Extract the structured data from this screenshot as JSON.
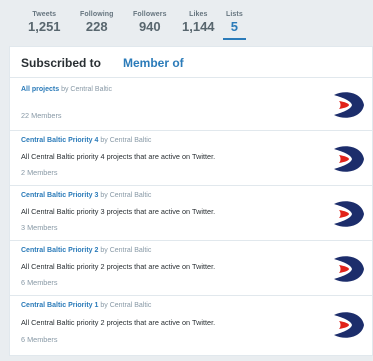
{
  "profile_nav": {
    "tweets": {
      "label": "Tweets",
      "value": "1,251"
    },
    "following": {
      "label": "Following",
      "value": "228"
    },
    "followers": {
      "label": "Followers",
      "value": "940"
    },
    "likes": {
      "label": "Likes",
      "value": "1,144"
    },
    "lists": {
      "label": "Lists",
      "value": "5"
    }
  },
  "panel": {
    "tab_subscribed": "Subscribed to",
    "tab_member": "Member of"
  },
  "lists": [
    {
      "name": "All projects",
      "by": "by Central Baltic",
      "description": "",
      "members": "22 Members"
    },
    {
      "name": "Central Baltic Priority 4",
      "by": "by Central Baltic",
      "description": "All Central Baltic priority 4 projects that are active on Twitter.",
      "members": "2 Members"
    },
    {
      "name": "Central Baltic Priority 3",
      "by": "by Central Baltic",
      "description": "All Central Baltic priority 3 projects that are active on Twitter.",
      "members": "3 Members"
    },
    {
      "name": "Central Baltic Priority 2",
      "by": "by Central Baltic",
      "description": "All Central Baltic priority 2 projects that are active on Twitter.",
      "members": "6 Members"
    },
    {
      "name": "Central Baltic Priority 1",
      "by": "by Central Baltic",
      "description": "All Central Baltic priority 2 projects that are active on Twitter.",
      "members": "6 Members"
    }
  ],
  "colors": {
    "accent": "#2b7bb9",
    "logo_navy": "#1c2d6b",
    "logo_red": "#e2231a"
  },
  "icons": {
    "list_logo": "central-baltic-logo-icon"
  }
}
